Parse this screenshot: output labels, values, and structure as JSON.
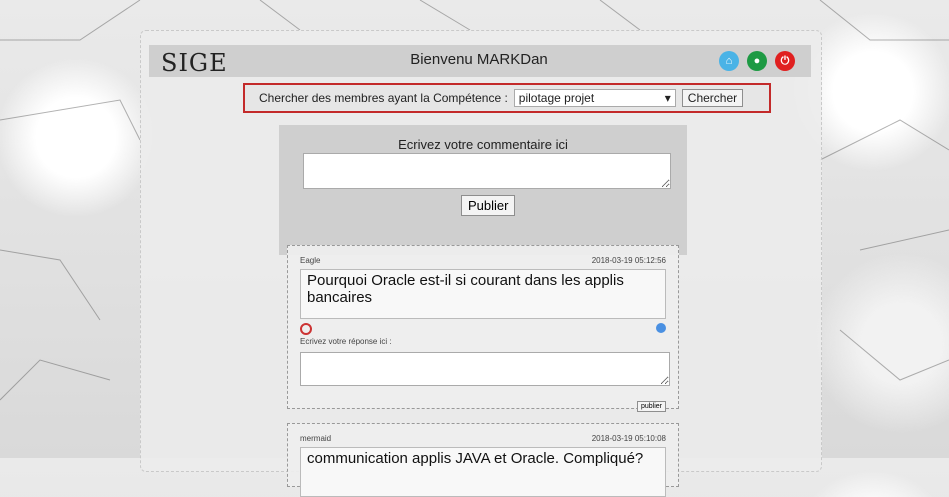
{
  "header": {
    "logo": "SIGE",
    "welcome": "Bienvenu MARKDan",
    "icons": [
      "home-icon",
      "user-icon",
      "power-icon"
    ]
  },
  "search": {
    "label": "Chercher des membres ayant la Compétence :",
    "selected": "pilotage projet",
    "button": "Chercher"
  },
  "composer": {
    "label": "Ecrivez votre commentaire ici",
    "button": "Publier"
  },
  "posts": [
    {
      "author": "Eagle",
      "timestamp": "2018-03-19 05:12:56",
      "question": "Pourquoi Oracle est-il si courant dans les applis bancaires",
      "reply_label": "Ecrivez votre réponse ici :",
      "reply_button": "publier"
    },
    {
      "author": "mermaid",
      "timestamp": "2018-03-19 05:10:08",
      "question": "communication applis JAVA et Oracle. Compliqué?"
    }
  ],
  "colors": {
    "search_border": "#c32a2a",
    "home_icon": "#4ab3e6",
    "user_icon": "#1e9a44",
    "power_icon": "#e02020"
  }
}
